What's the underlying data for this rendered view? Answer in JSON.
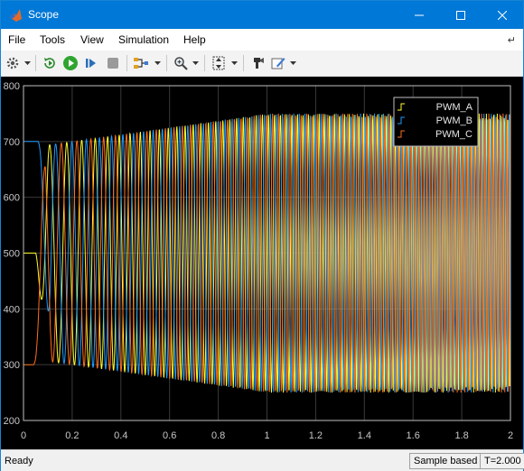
{
  "window": {
    "title": "Scope"
  },
  "menu": [
    "File",
    "Tools",
    "View",
    "Simulation",
    "Help"
  ],
  "toolbar": {
    "icons": [
      "gear-icon",
      "restore-icon",
      "run-icon",
      "step-forward-icon",
      "stop-icon",
      "signal-selector-icon",
      "zoom-icon",
      "autoscale-icon",
      "highlight-icon",
      "properties-icon"
    ]
  },
  "status": {
    "ready": "Ready",
    "mode": "Sample based",
    "time": "T=2.000"
  },
  "colors": {
    "plot_bg": "#000000",
    "axes": "#c0c0c0",
    "grid": "#3a3a3a",
    "pwm_a": "#ffff2e",
    "pwm_b": "#1e9bff",
    "pwm_c": "#ff6e1a",
    "titlebar": "#0078d7"
  },
  "chart_data": {
    "type": "line",
    "x_range": [
      0,
      2
    ],
    "y_range": [
      200,
      800
    ],
    "x_ticks": [
      "0",
      "0.2",
      "0.4",
      "0.6",
      "0.8",
      "1",
      "1.2",
      "1.4",
      "1.6",
      "1.8",
      "2"
    ],
    "y_ticks": [
      "200",
      "300",
      "400",
      "500",
      "600",
      "700",
      "800"
    ],
    "grid": true,
    "legend_position": "top-right",
    "series": [
      {
        "name": "PWM_A",
        "color": "#ffff2e",
        "start_value": 500,
        "settled_min": 250,
        "settled_max": 750
      },
      {
        "name": "PWM_B",
        "color": "#1e9bff",
        "start_value": 700,
        "settled_min": 250,
        "settled_max": 750
      },
      {
        "name": "PWM_C",
        "color": "#ff6e1a",
        "start_value": 300,
        "settled_min": 250,
        "settled_max": 750
      }
    ]
  }
}
